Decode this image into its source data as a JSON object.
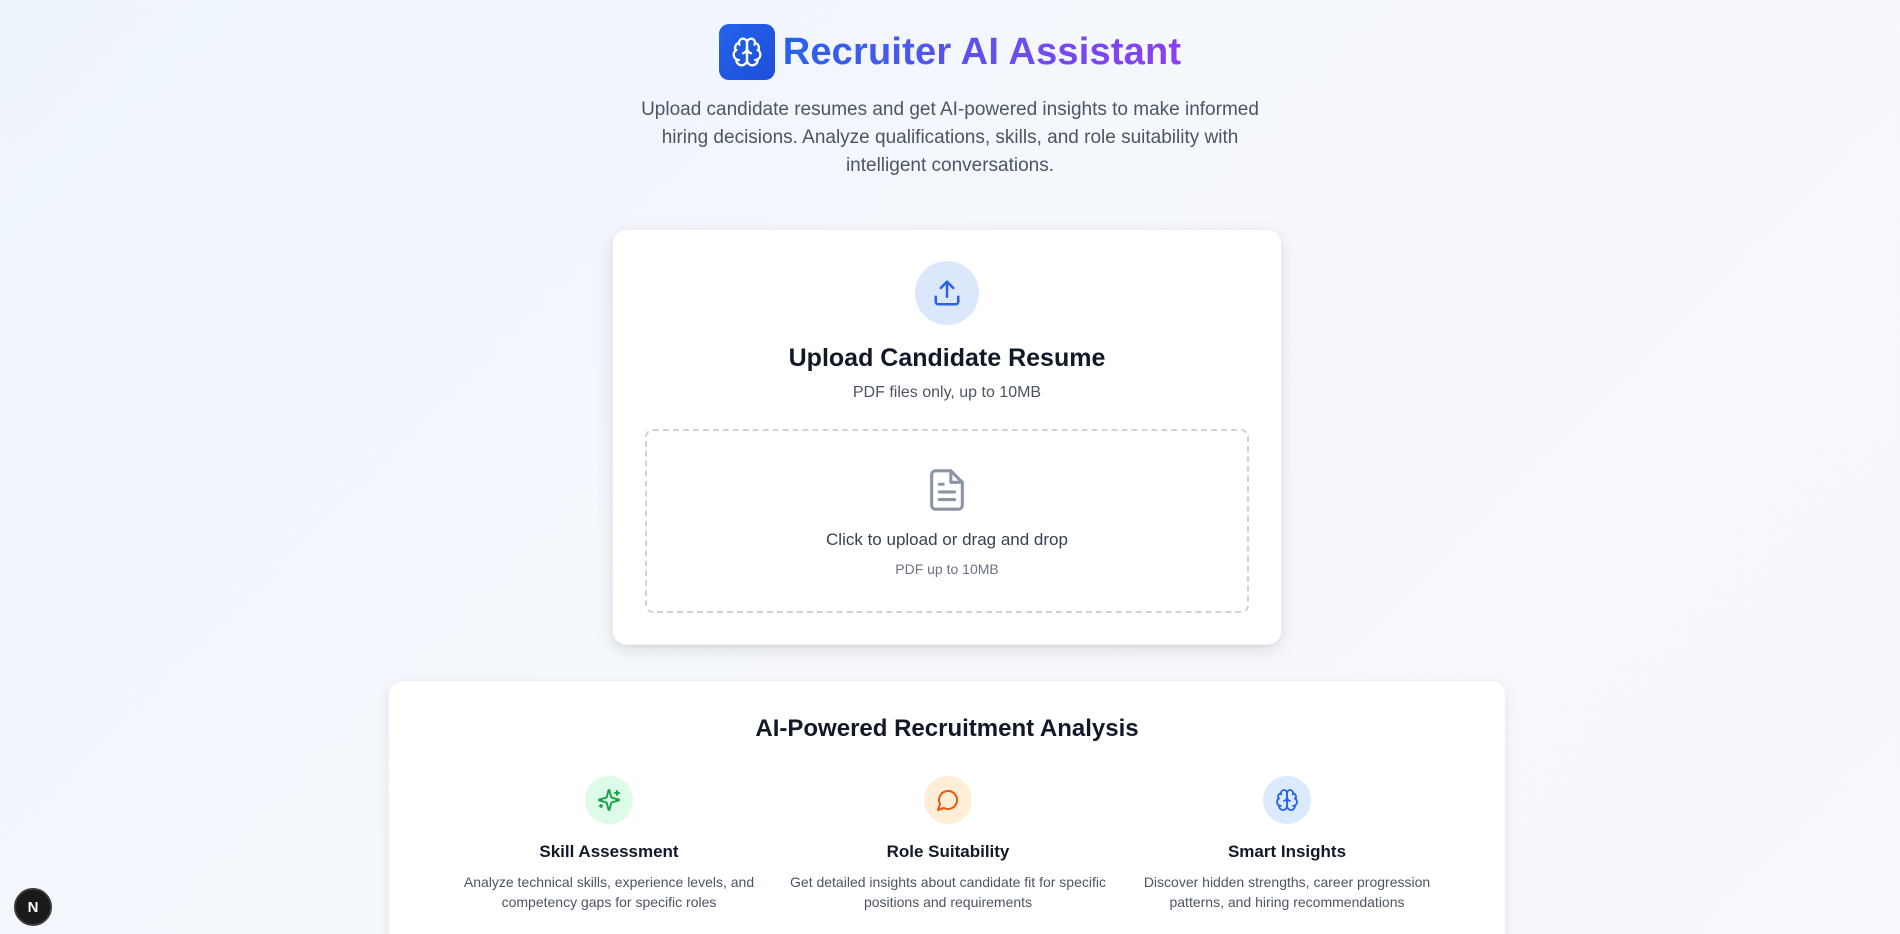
{
  "header": {
    "title": "Recruiter AI Assistant",
    "logo_icon": "brain-icon",
    "subtitle": "Upload candidate resumes and get AI-powered insights to make informed hiring decisions. Analyze qualifications, skills, and role suitability with intelligent conversations."
  },
  "upload": {
    "icon": "upload-icon",
    "title": "Upload Candidate Resume",
    "subtitle": "PDF files only, up to 10MB",
    "dropzone": {
      "icon": "file-text-icon",
      "main": "Click to upload or drag and drop",
      "sub": "PDF up to 10MB"
    }
  },
  "features": {
    "title": "AI-Powered Recruitment Analysis",
    "items": [
      {
        "icon": "sparkles-icon",
        "title": "Skill Assessment",
        "description": "Analyze technical skills, experience levels, and competency gaps for specific roles",
        "color": "#16a34a",
        "bg": "#dcfce7"
      },
      {
        "icon": "message-circle-icon",
        "title": "Role Suitability",
        "description": "Get detailed insights about candidate fit for specific positions and requirements",
        "color": "#ea580c",
        "bg": "#ffedd5"
      },
      {
        "icon": "brain-icon",
        "title": "Smart Insights",
        "description": "Discover hidden strengths, career progression patterns, and hiring recommendations",
        "color": "#2563eb",
        "bg": "#dbeafe"
      }
    ]
  },
  "badge": {
    "label": "N"
  },
  "colors": {
    "accent": "#2563eb",
    "accent_purple": "#8b3ff0"
  }
}
